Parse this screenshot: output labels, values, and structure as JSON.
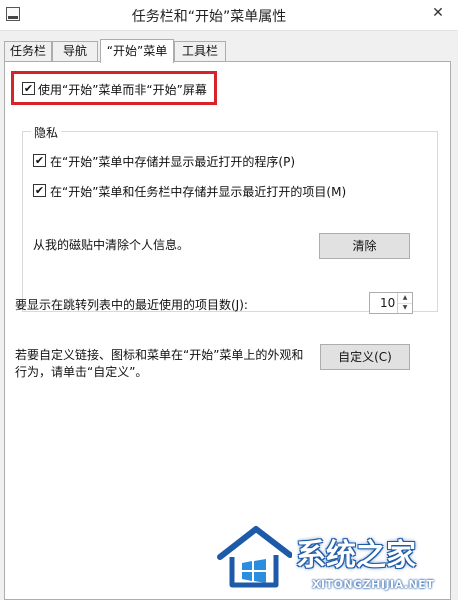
{
  "window": {
    "title": "任务栏和“开始”菜单属性"
  },
  "tabs": [
    {
      "label": "任务栏"
    },
    {
      "label": "导航"
    },
    {
      "label": "“开始”菜单"
    },
    {
      "label": "工具栏"
    }
  ],
  "start_screen": {
    "checked": true,
    "label": "使用“开始”菜单而非“开始”屏幕"
  },
  "privacy": {
    "title": "隐私",
    "store_programs": {
      "checked": true,
      "label": "在“开始”菜单中存储并显示最近打开的程序(P)"
    },
    "store_items": {
      "checked": true,
      "label": "在“开始”菜单和任务栏中存储并显示最近打开的项目(M)"
    },
    "clear_text": "从我的磁贴中清除个人信息。",
    "clear_button": "清除"
  },
  "jumplist": {
    "label": "要显示在跳转列表中的最近使用的项目数(J):",
    "value": "10"
  },
  "customize": {
    "text_line1": "若要自定义链接、图标和菜单在“开始”菜单上的外观和",
    "text_line2": "行为，请单击“自定义”。",
    "button": "自定义(C)"
  },
  "watermark": {
    "text": "系统之家",
    "url": "XITONGZHIJIA.NET"
  },
  "colors": {
    "highlight": "#d6242a",
    "watermark_blue": "#1d5aa8"
  },
  "icons": {
    "check": "check-icon",
    "close": "close-icon",
    "spin_up": "caret-up-icon",
    "spin_down": "caret-down-icon"
  }
}
